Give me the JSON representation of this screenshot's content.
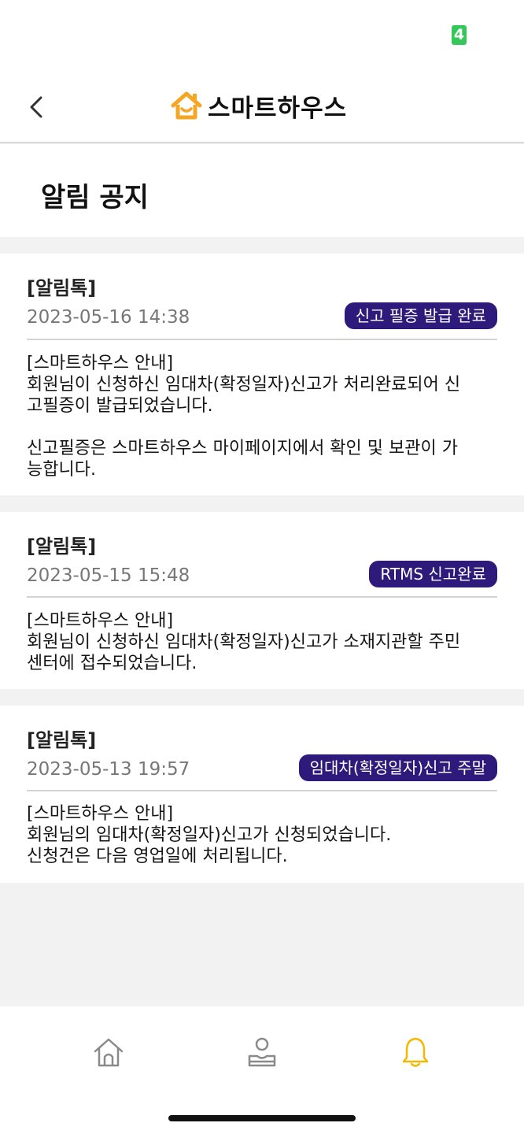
{
  "status_bar": {
    "battery_text": "4"
  },
  "header": {
    "back_icon": "chevron-left-icon",
    "logo_icon": "house-icon",
    "logo_text": "스마트하우스",
    "brand_color": "#f5a623"
  },
  "page": {
    "title": "알림 공지"
  },
  "notifications": [
    {
      "type": "[알림톡]",
      "date": "2023-05-16 14:38",
      "badge": "신고 필증 발급 완료",
      "lines": [
        "[스마트하우스 안내]",
        "회원님이 신청하신 임대차(확정일자)신고가 처리완료되어 신",
        "고필증이 발급되었습니다.",
        "",
        "신고필증은 스마트하우스 마이페이지에서 확인 및 보관이 가",
        "능합니다."
      ]
    },
    {
      "type": "[알림톡]",
      "date": "2023-05-15 15:48",
      "badge": "RTMS 신고완료",
      "lines": [
        "[스마트하우스 안내]",
        "회원님이 신청하신 임대차(확정일자)신고가 소재지관할 주민",
        "센터에 접수되었습니다."
      ]
    },
    {
      "type": "[알림톡]",
      "date": "2023-05-13 19:57",
      "badge": "임대차(확정일자)신고 주말",
      "lines": [
        "[스마트하우스 안내]",
        "회원님의 임대차(확정일자)신고가 신청되었습니다.",
        "신청건은 다음 영업일에 처리됩니다."
      ]
    }
  ],
  "badge_color": "#2d1a7a",
  "bottom_nav": {
    "items": [
      {
        "icon": "home-icon",
        "active": false
      },
      {
        "icon": "user-icon",
        "active": false
      },
      {
        "icon": "bell-icon",
        "active": true
      }
    ],
    "active_color": "#f5b800",
    "inactive_color": "#8a8a8a"
  }
}
